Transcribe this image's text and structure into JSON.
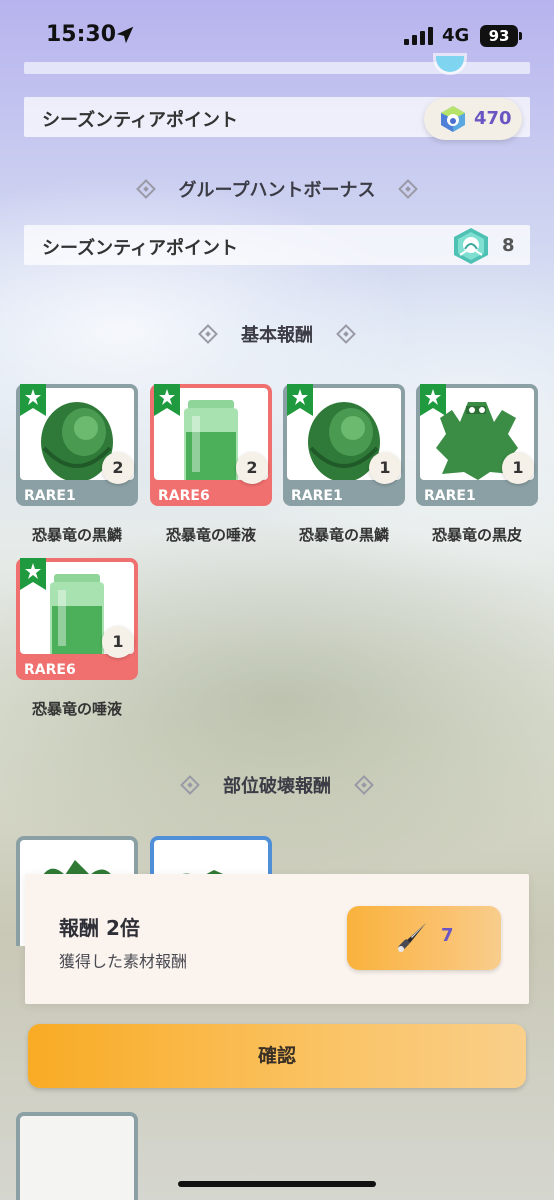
{
  "status_bar": {
    "time": "15:30",
    "network": "4G",
    "battery": "93"
  },
  "season_points": {
    "label": "シーズンティアポイント",
    "value": "470"
  },
  "group_hunt": {
    "title": "グループハントボーナス",
    "label": "シーズンティアポイント",
    "value": "8"
  },
  "basic_rewards": {
    "title": "基本報酬",
    "items": [
      {
        "name": "恐暴竜の黒鱗",
        "rarity": "RARE1",
        "count": "2",
        "kind": "scale"
      },
      {
        "name": "恐暴竜の唾液",
        "rarity": "RARE6",
        "count": "2",
        "kind": "jar"
      },
      {
        "name": "恐暴竜の黒鱗",
        "rarity": "RARE1",
        "count": "1",
        "kind": "scale"
      },
      {
        "name": "恐暴竜の黒皮",
        "rarity": "RARE1",
        "count": "1",
        "kind": "hide"
      },
      {
        "name": "恐暴竜の唾液",
        "rarity": "RARE6",
        "count": "1",
        "kind": "jar"
      }
    ]
  },
  "part_rewards": {
    "title": "部位破壊報酬"
  },
  "bonus": {
    "title": "報酬 2倍",
    "subtitle": "獲得した素材報酬",
    "button_value": "7"
  },
  "confirm_label": "確認",
  "colors": {
    "rare1": "#8aa0a4",
    "rare6": "#f06f6f",
    "accent": "#6a56c2",
    "button": "#f9ab24"
  },
  "icons": [
    "location-arrow-icon",
    "signal-icon",
    "season-gem-icon",
    "medal-icon",
    "star-flag-icon",
    "knife-icon"
  ]
}
